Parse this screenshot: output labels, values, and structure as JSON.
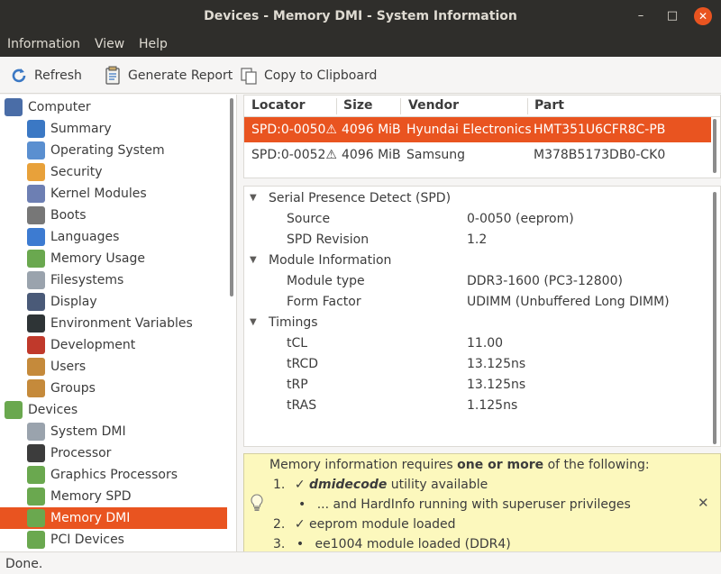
{
  "window": {
    "title": "Devices - Memory DMI - System Information",
    "minimize_glyph": "–",
    "maximize_glyph": "□",
    "close_glyph": "✕"
  },
  "menubar": {
    "items": [
      "Information",
      "View",
      "Help"
    ]
  },
  "toolbar": {
    "refresh": "Refresh",
    "generate_report": "Generate Report",
    "copy_clipboard": "Copy to Clipboard"
  },
  "sidebar": {
    "items": [
      {
        "label": "Computer",
        "icon": "computer-icon",
        "color": "#4a6da7",
        "level": 0
      },
      {
        "label": "Summary",
        "icon": "info-icon",
        "color": "#3b78c4",
        "level": 1
      },
      {
        "label": "Operating System",
        "icon": "gear-icon",
        "color": "#5a8fd0",
        "level": 1
      },
      {
        "label": "Security",
        "icon": "shield-icon",
        "color": "#e8a13a",
        "level": 1
      },
      {
        "label": "Kernel Modules",
        "icon": "module-icon",
        "color": "#6d7fb3",
        "level": 1
      },
      {
        "label": "Boots",
        "icon": "power-icon",
        "color": "#777777",
        "level": 1
      },
      {
        "label": "Languages",
        "icon": "flag-icon",
        "color": "#3d7bd1",
        "level": 1
      },
      {
        "label": "Memory Usage",
        "icon": "memory-icon",
        "color": "#6aa84f",
        "level": 1
      },
      {
        "label": "Filesystems",
        "icon": "document-icon",
        "color": "#9aa3ad",
        "level": 1
      },
      {
        "label": "Display",
        "icon": "monitor-icon",
        "color": "#4a5a78",
        "level": 1
      },
      {
        "label": "Environment Variables",
        "icon": "terminal-icon",
        "color": "#2e3436",
        "level": 1
      },
      {
        "label": "Development",
        "icon": "tools-icon",
        "color": "#c0392b",
        "level": 1
      },
      {
        "label": "Users",
        "icon": "users-icon",
        "color": "#c58a3b",
        "level": 1
      },
      {
        "label": "Groups",
        "icon": "group-icon",
        "color": "#c58a3b",
        "level": 1
      },
      {
        "label": "Devices",
        "icon": "devices-icon",
        "color": "#6aa84f",
        "level": 0
      },
      {
        "label": "System DMI",
        "icon": "board-icon",
        "color": "#9aa3ad",
        "level": 1
      },
      {
        "label": "Processor",
        "icon": "cpu-icon",
        "color": "#3c3c3c",
        "level": 1
      },
      {
        "label": "Graphics Processors",
        "icon": "gpu-icon",
        "color": "#6aa84f",
        "level": 1
      },
      {
        "label": "Memory SPD",
        "icon": "memory-icon",
        "color": "#6aa84f",
        "level": 1
      },
      {
        "label": "Memory DMI",
        "icon": "memory-icon",
        "color": "#6aa84f",
        "level": 1,
        "selected": true
      },
      {
        "label": "PCI Devices",
        "icon": "pci-icon",
        "color": "#6aa84f",
        "level": 1
      }
    ]
  },
  "devices_table": {
    "columns": [
      "Locator",
      "Size",
      "Vendor",
      "Part"
    ],
    "rows": [
      {
        "locator": "SPD:0-0050",
        "warn": "⚠",
        "size": "4096 MiB",
        "vendor": "Hyundai Electronics",
        "part": "HMT351U6CFR8C-PB",
        "selected": true
      },
      {
        "locator": "SPD:0-0052",
        "warn": "⚠",
        "size": "4096 MiB",
        "vendor": "Samsung",
        "part": "M378B5173DB0-CK0",
        "selected": false
      }
    ]
  },
  "details": {
    "expander_glyph": "▼",
    "sections": [
      {
        "title": "Serial Presence Detect (SPD)",
        "fields": [
          {
            "label": "Source",
            "value": "0-0050 (eeprom)"
          },
          {
            "label": "SPD Revision",
            "value": "1.2"
          }
        ]
      },
      {
        "title": "Module Information",
        "fields": [
          {
            "label": "Module type",
            "value": "DDR3-1600 (PC3-12800)"
          },
          {
            "label": "Form Factor",
            "value": "UDIMM (Unbuffered Long DIMM)"
          }
        ]
      },
      {
        "title": "Timings",
        "fields": [
          {
            "label": "tCL",
            "value": "11.00"
          },
          {
            "label": "tRCD",
            "value": "13.125ns"
          },
          {
            "label": "tRP",
            "value": "13.125ns"
          },
          {
            "label": "tRAS",
            "value": "1.125ns"
          }
        ]
      }
    ]
  },
  "note": {
    "intro": "Memory information requires ",
    "intro_bold": "one or more",
    "intro_tail": " of the following:",
    "check": "✓",
    "bullet": "•",
    "close_glyph": "✕",
    "item1_num": "1.",
    "item1_em": "dmidecode",
    "item1_rest": " utility available",
    "item1_sub": "... and HardInfo running with superuser privileges",
    "item2_num": "2.",
    "item2": "eeprom module loaded",
    "item3_num": "3.",
    "item3": "ee1004 module loaded (DDR4)"
  },
  "status": "Done."
}
